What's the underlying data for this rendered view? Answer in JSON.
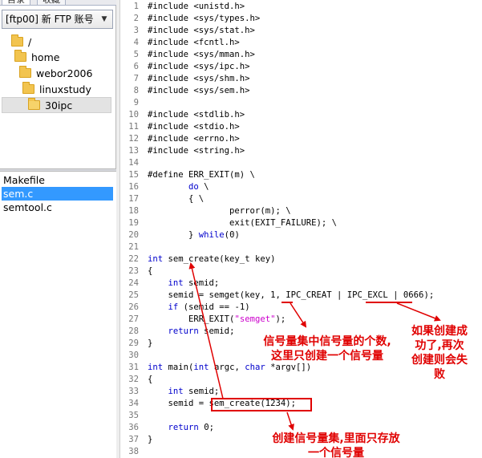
{
  "left_panel": {
    "tabs": [
      "目录",
      "收藏"
    ],
    "account_selector": "[ftp00] 新 FTP 账号",
    "dir_tree": [
      "/",
      "home",
      "webor2006",
      "linuxstudy",
      "30ipc"
    ],
    "selected_dir": "30ipc",
    "files": [
      "Makefile",
      "sem.c",
      "semtool.c"
    ],
    "selected_file": "sem.c"
  },
  "editor": {
    "lines": [
      {
        "n": "1",
        "t": "#include <unistd.h>"
      },
      {
        "n": "2",
        "t": "#include <sys/types.h>"
      },
      {
        "n": "3",
        "t": "#include <sys/stat.h>"
      },
      {
        "n": "4",
        "t": "#include <fcntl.h>"
      },
      {
        "n": "5",
        "t": "#include <sys/mman.h>"
      },
      {
        "n": "6",
        "t": "#include <sys/ipc.h>"
      },
      {
        "n": "7",
        "t": "#include <sys/shm.h>"
      },
      {
        "n": "8",
        "t": "#include <sys/sem.h>"
      },
      {
        "n": "9",
        "t": ""
      },
      {
        "n": "10",
        "t": "#include <stdlib.h>"
      },
      {
        "n": "11",
        "t": "#include <stdio.h>"
      },
      {
        "n": "12",
        "t": "#include <errno.h>"
      },
      {
        "n": "13",
        "t": "#include <string.h>"
      },
      {
        "n": "14",
        "t": ""
      },
      {
        "n": "15",
        "t": "#define ERR_EXIT(m) \\"
      },
      {
        "n": "16",
        "t": "        do \\"
      },
      {
        "n": "17",
        "t": "        { \\"
      },
      {
        "n": "18",
        "t": "                perror(m); \\"
      },
      {
        "n": "19",
        "t": "                exit(EXIT_FAILURE); \\"
      },
      {
        "n": "20",
        "t": "        } while(0)"
      },
      {
        "n": "21",
        "t": ""
      },
      {
        "n": "22",
        "t": "int sem_create(key_t key)"
      },
      {
        "n": "23",
        "t": "{"
      },
      {
        "n": "24",
        "t": "    int semid;"
      },
      {
        "n": "25",
        "t": "    semid = semget(key, 1, IPC_CREAT | IPC_EXCL | 0666);"
      },
      {
        "n": "26",
        "t": "    if (semid == -1)"
      },
      {
        "n": "27",
        "t": "        ERR_EXIT(\"semget\");"
      },
      {
        "n": "28",
        "t": "    return semid;"
      },
      {
        "n": "29",
        "t": "}"
      },
      {
        "n": "30",
        "t": ""
      },
      {
        "n": "31",
        "t": "int main(int argc, char *argv[])"
      },
      {
        "n": "32",
        "t": "{"
      },
      {
        "n": "33",
        "t": "    int semid;"
      },
      {
        "n": "34",
        "t": "    semid = sem_create(1234);"
      },
      {
        "n": "35",
        "t": ""
      },
      {
        "n": "36",
        "t": "    return 0;"
      },
      {
        "n": "37",
        "t": "}"
      },
      {
        "n": "38",
        "t": ""
      }
    ]
  },
  "annotations": {
    "note_sem_count": "信号量集中信号量的个数,\n这里只创建一个信号量",
    "note_excl": "如果创建成\n功了,再次\n创建则会失\n败",
    "note_create": "创建信号量集,里面只存放\n一个信号量",
    "accent_color": "#e00000"
  }
}
